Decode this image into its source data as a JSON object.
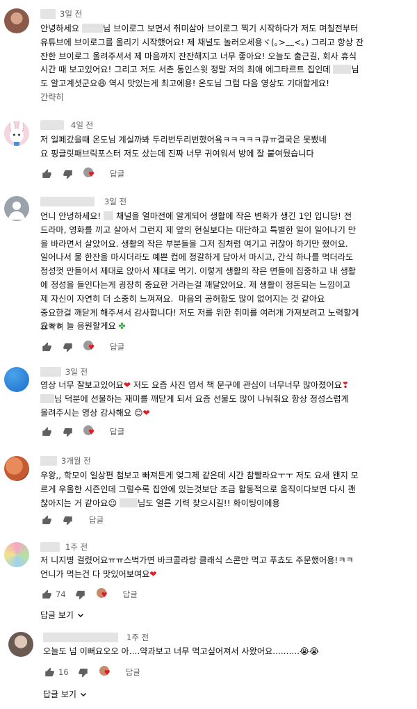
{
  "comments": [
    {
      "time": "3일 전",
      "text_before": "안녕하세요 ",
      "text_after": "님 브이로그 보면서 취미삼아 브이로그 찍기 시작하다가 저도 며칠전부터\n유튜브에 브이로그를 올리기 시작했어요! 제 채널도 놀러오세용ヾ(｡>﹏<｡) 그리고 항상 잔\n잔한 브이로그 올려주셔서 제 마음까지 잔잔해지고 너무 좋아요! 오늘도 출근길, 회사 휴식\n시간 때 보고있어요! 그리고 저도 서촌 통인스윗 정말 저의 최애 에그타르트 집인데 ",
      "text_after2": "님\n도 알고계셧군요",
      "text_after3": " 역시 맛있는게 최고에용! 온도님 그럼 다음 영상도 기대할게요!",
      "see_more": "간략히"
    },
    {
      "time": "4일 전",
      "text": "저 일페갔을때 온도님 계실까봐 두리번두리번했어욬ㅋㅋㅋㅋㅋ큐ㅠ결국은 못뵀네\n요 핑글릿패브릭포스터 저도 샀는데 진짜 너무 귀여워서 방에 잘 붙여뒀습니다",
      "reply_label": "답글"
    },
    {
      "time": "3일 전",
      "text_before": "언니 안녕하세요! ",
      "text_after": " 채널을 얼마전에 알게되어 생활에 작은 변화가 생긴 1인 입니당! 전\n드라마, 영화를 끼고 살아서 그런지 제 앞의 현실보다는 대단하고 특별한 일이 일어나기 만\n을 바라면서 살았어요. 생활의 작은 부분들을 그저 짐처럼 여기고 귀찮아 하기만 했어요.\n일어나서 물 한잔을 마시더라도 예쁜 컵에 정갈하게 담아서 마시고, 간식 하나를 먹더라도\n정성껏 만들어서 제대로 앉아서 제대로 먹기. 이렇게 생활의 작은 면들에 집중하고 내 생활\n에 정성을 들인다는게 굉장히 중요한 거라는걸 깨달았어요. 제 생활이 정돈되는 느낌이고\n제 자신이 자연히 더 소중히 느껴져요.  마음의 공허함도 많이 없어지는 것 같아요\n중요한걸 깨닫게 해주셔서 감사합니다! 저도 저를 위한 취미를 여러개 가져보려고 노력할게\n요ㅎㅎ 늘 응원할게요 ",
      "see_more": "간략히",
      "reply_label": "답글"
    },
    {
      "time": "3일 전",
      "text_line1": "영상 너무 잘보고있어요",
      "text_line1b": " 저도 요즘 사진 엽서 책 문구에 관심이 너무너무 많아졌어요",
      "text_line2": "님 덕분에 선물하는 재미를 깨닫게 되서 요즘 선물도 많이 나눠줘요 항상 정성스럽게\n올려주시는 영상 감사해요 ",
      "reply_label": "답글"
    },
    {
      "time": "3개월 전",
      "text_before": "우왕,, 학모이 일상편 첨보고 빠져든게 엊그제 같은데 시간 참빨라요ㅜㅜ 저도 요새 왠지 모\n르게 우울한 시즌인데 그럴수록 집안에 있는것보단 조금 활동적으로 움직이다보면 다시 괜\n찮아지는 거 같아요☺ ",
      "text_after": "님도 얼른 기력 찾으시길!! 화이팅이에용",
      "reply_label": "답글"
    },
    {
      "time": "1주 전",
      "text": "저 니지병 걸렸어요ㅠㅠ스벅가면 바크콜라랑 클래식 스콘만 먹고 푸쵸도 주문했어용!ㅋㅋ\n언니가 먹는건 다 맛있어보여요",
      "likes": "74",
      "reply_label": "답글",
      "view_replies": "답글 보기"
    },
    {
      "time": "1주 전",
      "text": "오늘도 넘 이뻐요오오 아....약과보고 너무 먹고싶어져서 사왔어요..........",
      "likes": "16",
      "reply_label": "답글",
      "view_replies": "답글 보기"
    }
  ],
  "icons": {
    "thumb_up": "thumb-up-icon",
    "thumb_down": "thumb-down-icon",
    "creator_heart": "creator-heart-icon",
    "chevron": "chevron-down-icon"
  },
  "colors": {
    "heart": "#e21b23",
    "secondary_text": "#606060"
  }
}
